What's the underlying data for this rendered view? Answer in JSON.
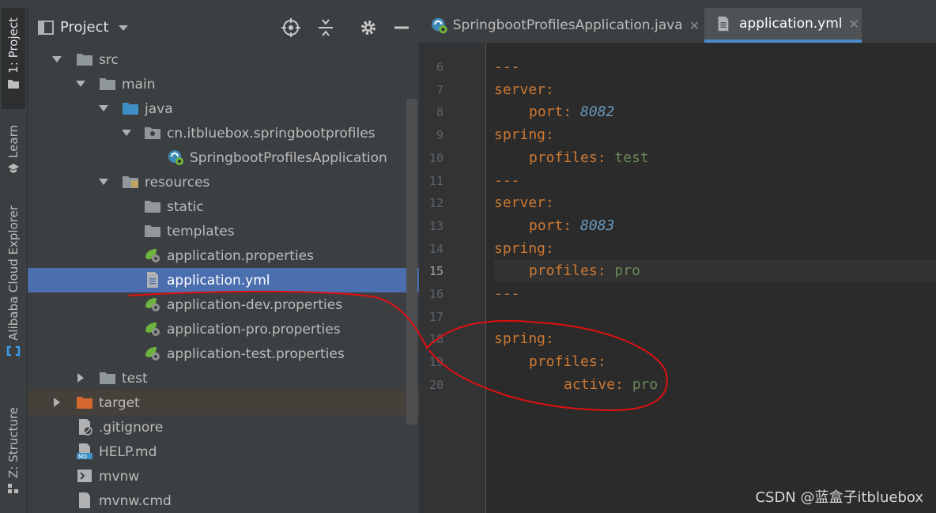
{
  "toolwindow": {
    "tabs": [
      {
        "label": "1: Project",
        "icon": "folder-icon"
      },
      {
        "label": "Learn",
        "icon": "graduation-cap-icon"
      },
      {
        "label": "Alibaba Cloud Explorer",
        "icon": "alibaba-cloud-icon"
      },
      {
        "label": "Z: Structure",
        "icon": "structure-icon"
      }
    ]
  },
  "project_panel": {
    "title": "Project",
    "buttons": [
      "locate-icon",
      "collapse-all-icon",
      "gear-icon",
      "minimize-icon"
    ],
    "tree": [
      {
        "label": "src",
        "icon": "folder-icon",
        "expanded": true
      },
      {
        "label": "main",
        "icon": "folder-icon",
        "expanded": true
      },
      {
        "label": "java",
        "icon": "source-folder-icon",
        "expanded": true
      },
      {
        "label": "cn.itbluebox.springbootprofiles",
        "icon": "package-icon",
        "expanded": true
      },
      {
        "label": "SpringbootProfilesApplication",
        "icon": "spring-boot-class-icon"
      },
      {
        "label": "resources",
        "icon": "resources-folder-icon",
        "expanded": true
      },
      {
        "label": "static",
        "icon": "folder-icon"
      },
      {
        "label": "templates",
        "icon": "folder-icon"
      },
      {
        "label": "application.properties",
        "icon": "spring-properties-icon"
      },
      {
        "label": "application.yml",
        "icon": "yaml-file-icon",
        "selected": true
      },
      {
        "label": "application-dev.properties",
        "icon": "spring-properties-icon"
      },
      {
        "label": "application-pro.properties",
        "icon": "spring-properties-icon"
      },
      {
        "label": "application-test.properties",
        "icon": "spring-properties-icon"
      },
      {
        "label": "test",
        "icon": "folder-icon",
        "expanded": false
      },
      {
        "label": "target",
        "icon": "excluded-folder-icon",
        "expanded": false
      },
      {
        "label": ".gitignore",
        "icon": "gitignore-file-icon"
      },
      {
        "label": "HELP.md",
        "icon": "markdown-file-icon"
      },
      {
        "label": "mvnw",
        "icon": "shell-script-icon"
      },
      {
        "label": "mvnw.cmd",
        "icon": "cmd-file-icon"
      }
    ]
  },
  "editor": {
    "tabs": [
      {
        "label": "SpringbootProfilesApplication.java",
        "icon": "spring-boot-class-icon",
        "active": false
      },
      {
        "label": "application.yml",
        "icon": "yaml-file-icon",
        "active": true
      }
    ],
    "current_line": "15",
    "lines": [
      {
        "no": "6",
        "key": "",
        "val": "---"
      },
      {
        "no": "7",
        "key": "server",
        "val": ""
      },
      {
        "no": "8",
        "key": "port",
        "val": "8082"
      },
      {
        "no": "9",
        "key": "spring",
        "val": ""
      },
      {
        "no": "10",
        "key": "profiles",
        "val": "test"
      },
      {
        "no": "11",
        "key": "",
        "val": "---"
      },
      {
        "no": "12",
        "key": "server",
        "val": ""
      },
      {
        "no": "13",
        "key": "port",
        "val": "8083"
      },
      {
        "no": "14",
        "key": "spring",
        "val": ""
      },
      {
        "no": "15",
        "key": "profiles",
        "val": "pro"
      },
      {
        "no": "16",
        "key": "",
        "val": "---"
      },
      {
        "no": "17",
        "key": "",
        "val": ""
      },
      {
        "no": "18",
        "key": "spring",
        "val": ""
      },
      {
        "no": "19",
        "key": "profiles",
        "val": ""
      },
      {
        "no": "20",
        "key": "active",
        "val": "pro"
      }
    ]
  },
  "watermark": "CSDN @蓝盒子itbluebox",
  "colors": {
    "selection": "#4b6eaf",
    "yaml_key": "#cc7832",
    "yaml_number": "#6897bb",
    "yaml_string": "#6a8759",
    "annotation": "#e01010"
  }
}
